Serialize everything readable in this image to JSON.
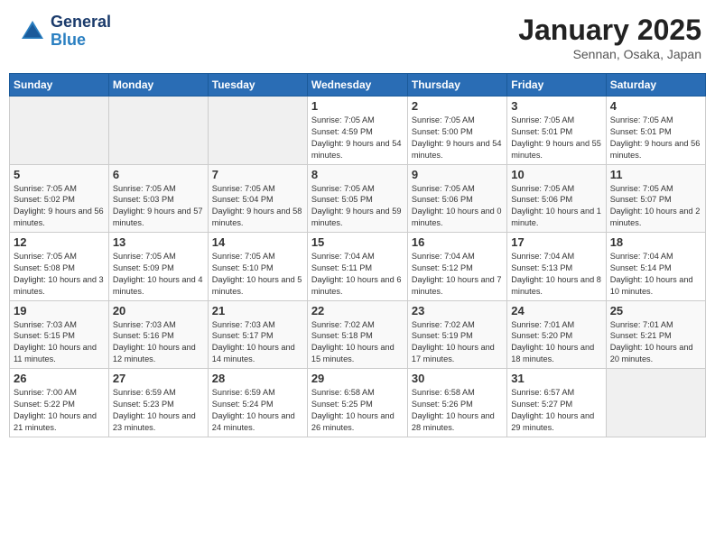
{
  "header": {
    "logo_line1": "General",
    "logo_line2": "Blue",
    "month": "January 2025",
    "location": "Sennan, Osaka, Japan"
  },
  "days_of_week": [
    "Sunday",
    "Monday",
    "Tuesday",
    "Wednesday",
    "Thursday",
    "Friday",
    "Saturday"
  ],
  "weeks": [
    [
      {
        "num": "",
        "empty": true
      },
      {
        "num": "",
        "empty": true
      },
      {
        "num": "",
        "empty": true
      },
      {
        "num": "1",
        "sunrise": "7:05 AM",
        "sunset": "4:59 PM",
        "daylight": "9 hours and 54 minutes."
      },
      {
        "num": "2",
        "sunrise": "7:05 AM",
        "sunset": "5:00 PM",
        "daylight": "9 hours and 54 minutes."
      },
      {
        "num": "3",
        "sunrise": "7:05 AM",
        "sunset": "5:01 PM",
        "daylight": "9 hours and 55 minutes."
      },
      {
        "num": "4",
        "sunrise": "7:05 AM",
        "sunset": "5:01 PM",
        "daylight": "9 hours and 56 minutes."
      }
    ],
    [
      {
        "num": "5",
        "sunrise": "7:05 AM",
        "sunset": "5:02 PM",
        "daylight": "9 hours and 56 minutes."
      },
      {
        "num": "6",
        "sunrise": "7:05 AM",
        "sunset": "5:03 PM",
        "daylight": "9 hours and 57 minutes."
      },
      {
        "num": "7",
        "sunrise": "7:05 AM",
        "sunset": "5:04 PM",
        "daylight": "9 hours and 58 minutes."
      },
      {
        "num": "8",
        "sunrise": "7:05 AM",
        "sunset": "5:05 PM",
        "daylight": "9 hours and 59 minutes."
      },
      {
        "num": "9",
        "sunrise": "7:05 AM",
        "sunset": "5:06 PM",
        "daylight": "10 hours and 0 minutes."
      },
      {
        "num": "10",
        "sunrise": "7:05 AM",
        "sunset": "5:06 PM",
        "daylight": "10 hours and 1 minute."
      },
      {
        "num": "11",
        "sunrise": "7:05 AM",
        "sunset": "5:07 PM",
        "daylight": "10 hours and 2 minutes."
      }
    ],
    [
      {
        "num": "12",
        "sunrise": "7:05 AM",
        "sunset": "5:08 PM",
        "daylight": "10 hours and 3 minutes."
      },
      {
        "num": "13",
        "sunrise": "7:05 AM",
        "sunset": "5:09 PM",
        "daylight": "10 hours and 4 minutes."
      },
      {
        "num": "14",
        "sunrise": "7:05 AM",
        "sunset": "5:10 PM",
        "daylight": "10 hours and 5 minutes."
      },
      {
        "num": "15",
        "sunrise": "7:04 AM",
        "sunset": "5:11 PM",
        "daylight": "10 hours and 6 minutes."
      },
      {
        "num": "16",
        "sunrise": "7:04 AM",
        "sunset": "5:12 PM",
        "daylight": "10 hours and 7 minutes."
      },
      {
        "num": "17",
        "sunrise": "7:04 AM",
        "sunset": "5:13 PM",
        "daylight": "10 hours and 8 minutes."
      },
      {
        "num": "18",
        "sunrise": "7:04 AM",
        "sunset": "5:14 PM",
        "daylight": "10 hours and 10 minutes."
      }
    ],
    [
      {
        "num": "19",
        "sunrise": "7:03 AM",
        "sunset": "5:15 PM",
        "daylight": "10 hours and 11 minutes."
      },
      {
        "num": "20",
        "sunrise": "7:03 AM",
        "sunset": "5:16 PM",
        "daylight": "10 hours and 12 minutes."
      },
      {
        "num": "21",
        "sunrise": "7:03 AM",
        "sunset": "5:17 PM",
        "daylight": "10 hours and 14 minutes."
      },
      {
        "num": "22",
        "sunrise": "7:02 AM",
        "sunset": "5:18 PM",
        "daylight": "10 hours and 15 minutes."
      },
      {
        "num": "23",
        "sunrise": "7:02 AM",
        "sunset": "5:19 PM",
        "daylight": "10 hours and 17 minutes."
      },
      {
        "num": "24",
        "sunrise": "7:01 AM",
        "sunset": "5:20 PM",
        "daylight": "10 hours and 18 minutes."
      },
      {
        "num": "25",
        "sunrise": "7:01 AM",
        "sunset": "5:21 PM",
        "daylight": "10 hours and 20 minutes."
      }
    ],
    [
      {
        "num": "26",
        "sunrise": "7:00 AM",
        "sunset": "5:22 PM",
        "daylight": "10 hours and 21 minutes."
      },
      {
        "num": "27",
        "sunrise": "6:59 AM",
        "sunset": "5:23 PM",
        "daylight": "10 hours and 23 minutes."
      },
      {
        "num": "28",
        "sunrise": "6:59 AM",
        "sunset": "5:24 PM",
        "daylight": "10 hours and 24 minutes."
      },
      {
        "num": "29",
        "sunrise": "6:58 AM",
        "sunset": "5:25 PM",
        "daylight": "10 hours and 26 minutes."
      },
      {
        "num": "30",
        "sunrise": "6:58 AM",
        "sunset": "5:26 PM",
        "daylight": "10 hours and 28 minutes."
      },
      {
        "num": "31",
        "sunrise": "6:57 AM",
        "sunset": "5:27 PM",
        "daylight": "10 hours and 29 minutes."
      },
      {
        "num": "",
        "empty": true
      }
    ]
  ]
}
